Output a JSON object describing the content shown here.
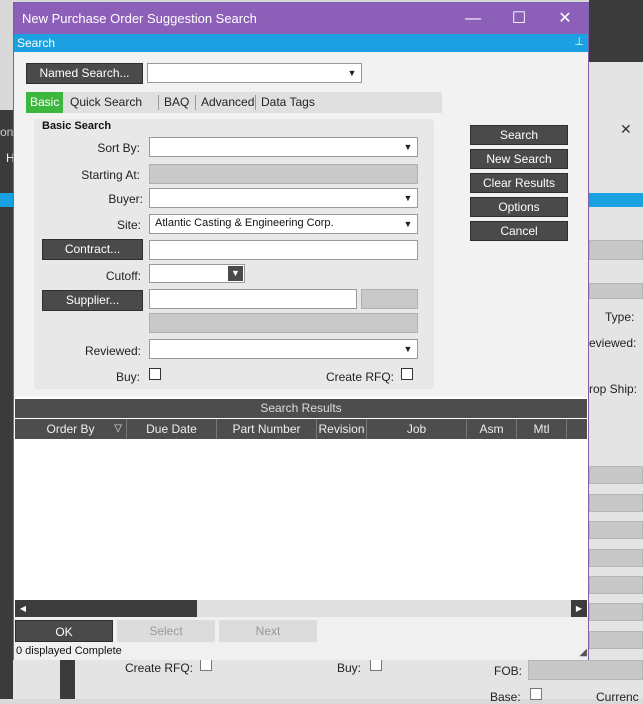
{
  "background": {
    "labels": {
      "type": "Type:",
      "reviewed": "eviewed:",
      "drop_ship": "rop Ship:",
      "create_rfq": "Create RFQ:",
      "buy": "Buy:",
      "fob": "FOB:",
      "base": "Base:",
      "currency": "Currenc",
      "h_letter": "H",
      "on_letters": "on"
    }
  },
  "dialog": {
    "title": "New Purchase Order Suggestion Search",
    "search_bar_label": "Search",
    "named_search": {
      "label": "Named Search...",
      "value": ""
    },
    "tabs": [
      "Basic",
      "Quick Search",
      "BAQ",
      "Advanced",
      "Data Tags"
    ],
    "active_tab": "Basic",
    "group_title": "Basic Search",
    "fields": {
      "sort_by": {
        "label": "Sort By:",
        "value": ""
      },
      "starting_at": {
        "label": "Starting At:",
        "value": ""
      },
      "buyer": {
        "label": "Buyer:",
        "value": ""
      },
      "site": {
        "label": "Site:",
        "value": "Atlantic Casting & Engineering Corp."
      },
      "contract": {
        "label": "Contract...",
        "value": ""
      },
      "cutoff": {
        "label": "Cutoff:",
        "value": ""
      },
      "supplier": {
        "label": "Supplier...",
        "value": ""
      },
      "reviewed": {
        "label": "Reviewed:",
        "value": ""
      },
      "buy": {
        "label": "Buy:"
      },
      "create_rfq": {
        "label": "Create RFQ:"
      }
    },
    "side_buttons": [
      "Search",
      "New Search",
      "Clear Results",
      "Options",
      "Cancel"
    ],
    "results": {
      "title": "Search Results",
      "columns": [
        "Order By",
        "Due Date",
        "Part Number",
        "Revision",
        "Job",
        "Asm",
        "Mtl"
      ]
    },
    "footer": {
      "ok": "OK",
      "select": "Select",
      "next": "Next",
      "status": "0 displayed Complete"
    }
  }
}
